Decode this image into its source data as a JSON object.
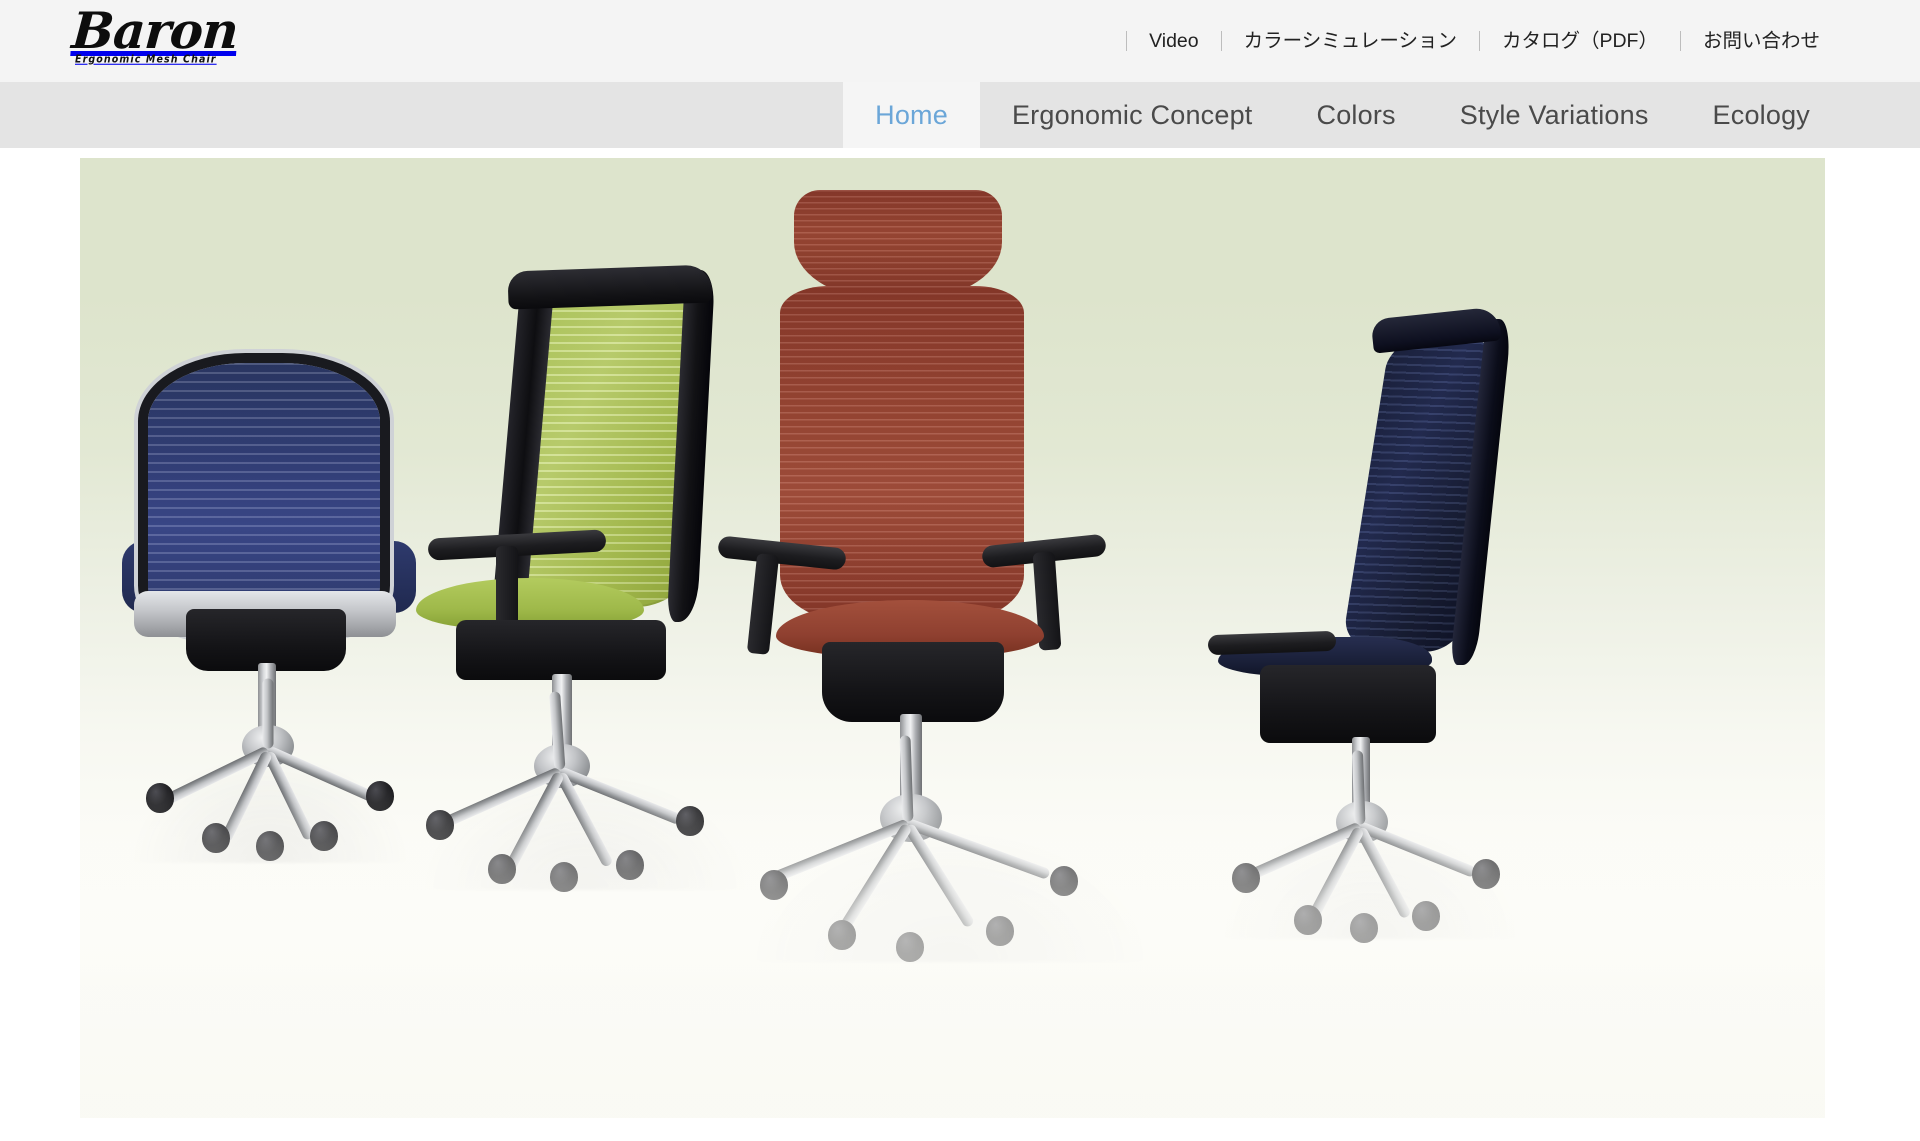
{
  "header": {
    "brand": {
      "name": "Baron",
      "tagline": "Ergonomic Mesh Chair"
    },
    "utility_nav": [
      {
        "label": "Video"
      },
      {
        "label": "カラーシミュレーション"
      },
      {
        "label": "カタログ（PDF）"
      },
      {
        "label": "お問い合わせ"
      }
    ]
  },
  "main_nav": {
    "active_index": 0,
    "tabs": [
      {
        "label": "Home"
      },
      {
        "label": "Ergonomic Concept"
      },
      {
        "label": "Colors"
      },
      {
        "label": "Style Variations"
      },
      {
        "label": "Ecology"
      }
    ]
  },
  "hero": {
    "description": "Four Baron ergonomic mesh office chairs on a reflective floor with a pale green to white gradient backdrop",
    "background_top_color": "#dde4cc",
    "background_bottom_color": "#fcfcf8",
    "chairs": [
      {
        "name": "chair-blue-rear",
        "view": "rear",
        "mesh_color": "#3c4a8e",
        "frame_color": "#191a1f",
        "has_headrest": false
      },
      {
        "name": "chair-green-three-quarter",
        "view": "three-quarter-rear",
        "mesh_color": "#b7cf63",
        "frame_color": "#0e0e11",
        "has_headrest": false
      },
      {
        "name": "chair-rust-front",
        "view": "front-three-quarter",
        "mesh_color": "#9f4936",
        "frame_color": "#141417",
        "has_headrest": true
      },
      {
        "name": "chair-navy-side",
        "view": "side",
        "mesh_color": "#27305a",
        "frame_color": "#0b0d1a",
        "has_headrest": false
      }
    ]
  },
  "theme": {
    "header_bg": "#f4f4f4",
    "nav_bg": "#e4e4e4",
    "nav_active_bg": "#f5f5f5",
    "nav_active_text": "#6ba6d8",
    "nav_text": "#4a4a4a",
    "utility_text": "#222222",
    "page_bg": "#ffffff"
  }
}
